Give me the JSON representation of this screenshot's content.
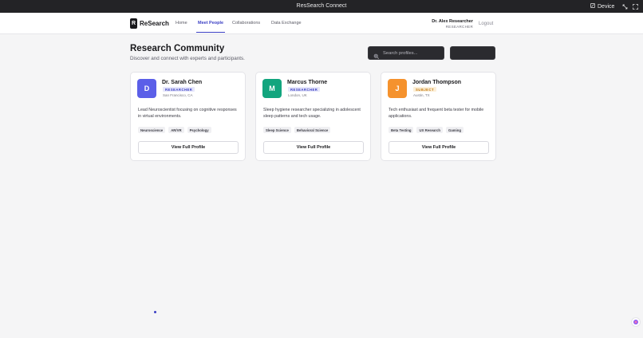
{
  "window": {
    "title": "ResSearch Connect",
    "device_label": "Device",
    "icons": [
      "device-icon",
      "rotate-icon",
      "fullscreen-icon"
    ]
  },
  "nav": {
    "logo_letter": "R",
    "logo_text": "ReSearch",
    "links": [
      "Home",
      "Meet People",
      "Collaborations",
      "Data Exchange"
    ],
    "active_link": "Meet People",
    "user_name": "Dr. Alex Researcher",
    "user_role": "RESEARCHER",
    "logout_label": "Logout"
  },
  "page": {
    "title": "Research Community",
    "subtitle": "Discover and connect with experts and participants.",
    "search_placeholder": "Search profiles...",
    "button_label": ""
  },
  "profiles": [
    {
      "initial": "D",
      "name": "Dr. Sarah Chen",
      "role": "RESEARCHER",
      "location": "San Francisco, CA",
      "bio": "Lead Neuroscientist focusing on cognitive responses in virtual environments.",
      "tags": [
        "Neuroscience",
        "AR/VR",
        "Psychology"
      ],
      "button_label": "View Full Profile",
      "color": "#5b5fe8"
    },
    {
      "initial": "M",
      "name": "Marcus Thorne",
      "role": "RESEARCHER",
      "location": "London, UK",
      "bio": "Sleep hygiene researcher specializing in adolescent sleep patterns and tech usage.",
      "tags": [
        "Sleep Science",
        "Behavioral Science"
      ],
      "button_label": "View Full Profile",
      "color": "#12a57e"
    },
    {
      "initial": "J",
      "name": "Jordan Thompson",
      "role": "SUBJECT",
      "location": "Austin, TX",
      "bio": "Tech enthusiast and frequent beta tester for mobile applications.",
      "tags": [
        "Beta Testing",
        "UX Research",
        "Gaming"
      ],
      "button_label": "View Full Profile",
      "color": "#f5922d"
    }
  ],
  "colors": {
    "accent": "#3b3fc4",
    "titlebar": "#232326",
    "background": "#f5f5f6"
  }
}
